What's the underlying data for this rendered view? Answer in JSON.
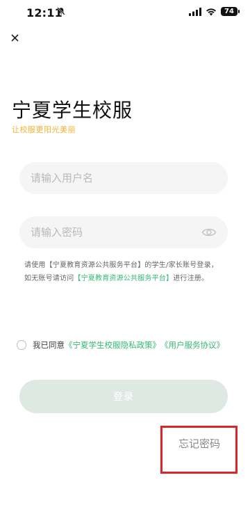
{
  "status_bar": {
    "time": "12:11",
    "battery": "74",
    "icons": [
      "mute-bell-icon",
      "signal-icon",
      "wifi-icon",
      "battery-icon"
    ]
  },
  "header": {
    "close_icon": "close-icon",
    "title": "宁夏学生校服",
    "subtitle": "让校服更阳光美丽"
  },
  "form": {
    "username_placeholder": "请输入用户名",
    "password_placeholder": "请输入密码",
    "eye_icon": "eye-icon",
    "notice": {
      "part1": "请使用【宁夏教育资源公共服务平台】的学生/家长账号登录，如无账号请访问",
      "link": "【宁夏教育资源公共服务平台】",
      "part2": "进行注册。"
    }
  },
  "agreement": {
    "prefix": "我已同意",
    "privacy_policy": "《宁夏学生校服隐私政策》",
    "service_agreement": "《用户服务协议》"
  },
  "actions": {
    "login": "登录",
    "forgot_password": "忘记密码"
  },
  "colors": {
    "accent_green": "#35b878",
    "subtitle_yellow": "#f1b230",
    "login_disabled": "#dfe9e4",
    "highlight_red": "#d92626"
  }
}
